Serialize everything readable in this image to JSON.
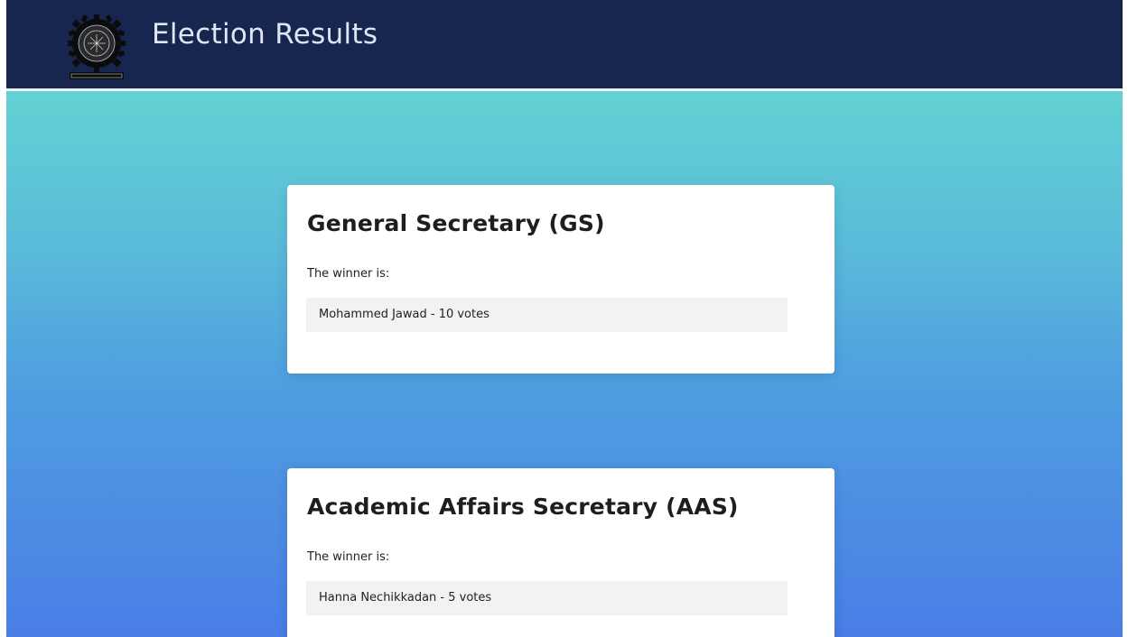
{
  "header": {
    "title": "Election Results",
    "logo_icon": "institute-emblem-icon",
    "background_color": "#16264f"
  },
  "positions": [
    {
      "title": "General Secretary (GS)",
      "winner_label": "The winner is:",
      "result": "Mohammed Jawad - 10 votes"
    },
    {
      "title": "Academic Affairs Secretary (AAS)",
      "winner_label": "The winner is:",
      "result": "Hanna Nechikkadan - 5 votes"
    }
  ],
  "colors": {
    "gradient_top": "#66ddd0",
    "gradient_bottom": "#4a7ee6",
    "card": "#ffffff",
    "result_box": "#f2f2f2"
  }
}
